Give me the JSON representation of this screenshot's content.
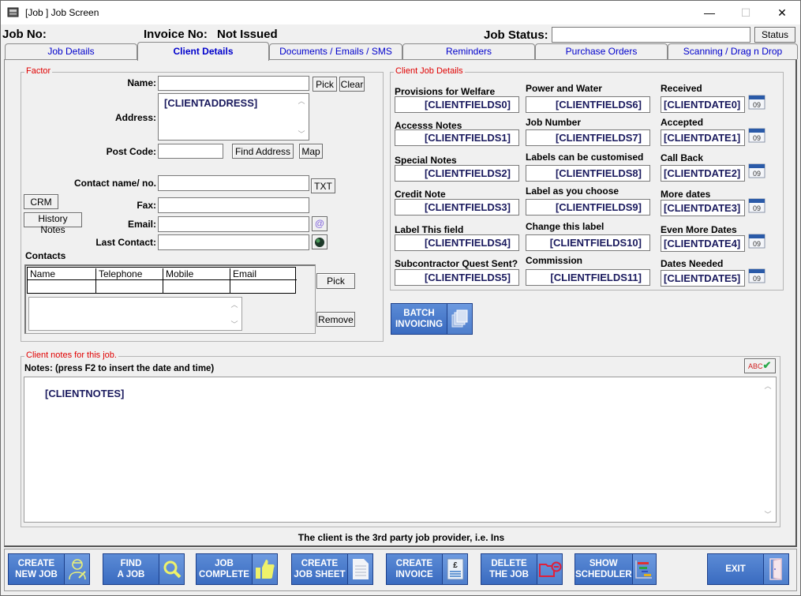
{
  "window": {
    "title": "[Job ] Job Screen",
    "controls": {
      "minimize": "—",
      "maximize": "☐",
      "close": "✕"
    }
  },
  "header": {
    "job_no_label": "Job No:",
    "invoice_no_label": "Invoice No:",
    "invoice_no_value": "Not Issued",
    "job_status_label": "Job Status:",
    "job_status_value": "",
    "status_button": "Status"
  },
  "tabs": [
    {
      "label": "Job Details",
      "active": false
    },
    {
      "label": "Client Details",
      "active": true
    },
    {
      "label": "Documents / Emails / SMS",
      "active": false
    },
    {
      "label": "Reminders",
      "active": false
    },
    {
      "label": "Purchase Orders",
      "active": false
    },
    {
      "label": "Scanning / Drag n Drop",
      "active": false
    }
  ],
  "factor": {
    "legend": "Factor",
    "name_label": "Name:",
    "name_value": "",
    "pick": "Pick",
    "clear": "Clear",
    "address_label": "Address:",
    "address_value": "[CLIENTADDRESS]",
    "postcode_label": "Post Code:",
    "postcode_value": "",
    "find_address": "Find Address",
    "map": "Map",
    "contact_label": "Contact name/ no.",
    "contact_value": "",
    "txt": "TXT",
    "crm": "CRM",
    "history_notes": "History Notes",
    "fax_label": "Fax:",
    "fax_value": "",
    "email_label": "Email:",
    "email_value": "",
    "last_contact_label": "Last Contact:",
    "last_contact_value": "",
    "contacts_label": "Contacts",
    "contacts_columns": [
      "Name",
      "Telephone",
      "Mobile",
      "Email"
    ],
    "contacts_pick": "Pick",
    "contacts_remove": "Remove"
  },
  "client_job_details": {
    "legend": "Client Job Details",
    "col1": [
      {
        "label": "Provisions for Welfare",
        "value": "[CLIENTFIELDS0]"
      },
      {
        "label": "Accesss Notes",
        "value": "[CLIENTFIELDS1]"
      },
      {
        "label": "Special Notes",
        "value": "[CLIENTFIELDS2]"
      },
      {
        "label": "Credit Note",
        "value": "[CLIENTFIELDS3]"
      },
      {
        "label": "Label This field",
        "value": "[CLIENTFIELDS4]"
      },
      {
        "label": "Subcontractor Quest Sent?",
        "value": "[CLIENTFIELDS5]"
      }
    ],
    "col2": [
      {
        "label": "Power and Water",
        "value": "[CLIENTFIELDS6]"
      },
      {
        "label": "Job Number",
        "value": "[CLIENTFIELDS7]"
      },
      {
        "label": "Labels can be customised",
        "value": "[CLIENTFIELDS8]"
      },
      {
        "label": "Label as you choose",
        "value": "[CLIENTFIELDS9]"
      },
      {
        "label": "Change this label",
        "value": "[CLIENTFIELDS10]"
      },
      {
        "label": "Commission",
        "value": "[CLIENTFIELDS11]"
      }
    ],
    "col3": [
      {
        "label": "Received",
        "value": "[CLIENTDATE0]"
      },
      {
        "label": "Accepted",
        "value": "[CLIENTDATE1]"
      },
      {
        "label": "Call Back",
        "value": "[CLIENTDATE2]"
      },
      {
        "label": "More dates",
        "value": "[CLIENTDATE3]"
      },
      {
        "label": "Even More Dates",
        "value": "[CLIENTDATE4]"
      },
      {
        "label": "Dates Needed",
        "value": "[CLIENTDATE5]"
      }
    ],
    "calendar_icon_text": "09"
  },
  "batch_invoicing": "BATCH\nINVOICING",
  "notes": {
    "legend": "Client notes for this job.",
    "label": "Notes: (press F2 to insert the date and time)",
    "value": "[CLIENTNOTES]",
    "spellcheck_text": "ABC"
  },
  "footer_text": "The client is the 3rd party job provider, i.e. Ins",
  "bottom_buttons": [
    {
      "label": "CREATE\nNEW JOB",
      "icon": "worker-icon"
    },
    {
      "label": "FIND\nA JOB",
      "icon": "magnifier-icon"
    },
    {
      "label": "JOB\nCOMPLETE",
      "icon": "thumbs-up-icon"
    },
    {
      "label": "CREATE\nJOB SHEET",
      "icon": "document-icon"
    },
    {
      "label": "CREATE\nINVOICE",
      "icon": "invoice-pound-icon"
    },
    {
      "label": "DELETE\nTHE JOB",
      "icon": "folder-delete-icon"
    },
    {
      "label": "SHOW\nSCHEDULER",
      "icon": "gantt-icon"
    },
    {
      "label": "EXIT",
      "icon": "door-icon"
    }
  ]
}
